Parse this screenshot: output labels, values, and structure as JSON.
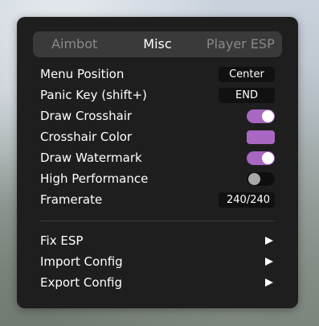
{
  "tabs": [
    {
      "label": "Aimbot",
      "active": false
    },
    {
      "label": "Misc",
      "active": true
    },
    {
      "label": "Player ESP",
      "active": false
    }
  ],
  "settings": {
    "menu_position": {
      "label": "Menu Position",
      "value": "Center"
    },
    "panic_key": {
      "label": "Panic Key (shift+)",
      "value": "END"
    },
    "draw_crosshair": {
      "label": "Draw Crosshair",
      "on": true
    },
    "crosshair_color": {
      "label": "Crosshair Color",
      "color": "#a767c2"
    },
    "draw_watermark": {
      "label": "Draw Watermark",
      "on": true
    },
    "high_performance": {
      "label": "High Performance",
      "on": false
    },
    "framerate": {
      "label": "Framerate",
      "value": "240/240"
    }
  },
  "actions": [
    {
      "label": "Fix ESP",
      "icon": "right-arrow-icon"
    },
    {
      "label": "Import Config",
      "icon": "right-arrow-icon"
    },
    {
      "label": "Export Config",
      "icon": "right-arrow-icon"
    }
  ],
  "colors": {
    "accent": "#a767c2",
    "panel": "#1e1e1e",
    "tab_bar": "#3a3a3a"
  }
}
